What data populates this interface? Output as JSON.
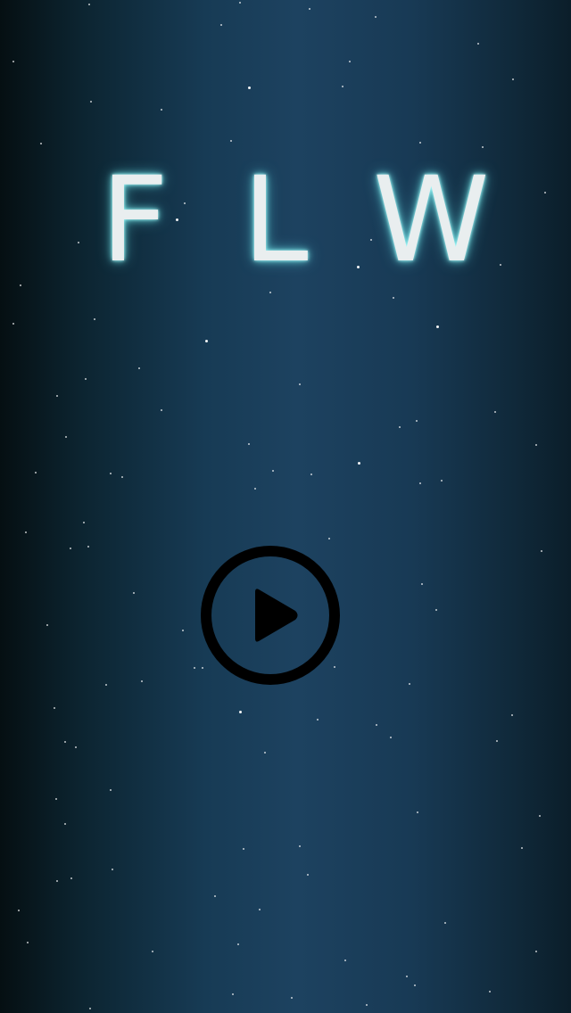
{
  "title": {
    "letters": [
      "F",
      "L",
      "W"
    ]
  },
  "play_button": {
    "icon": "play-icon",
    "color": "#000000"
  },
  "colors": {
    "title_text": "#e9eeef",
    "title_glow": "#78f0f0",
    "background_center": "#1d4260",
    "background_edge": "#050f12"
  }
}
